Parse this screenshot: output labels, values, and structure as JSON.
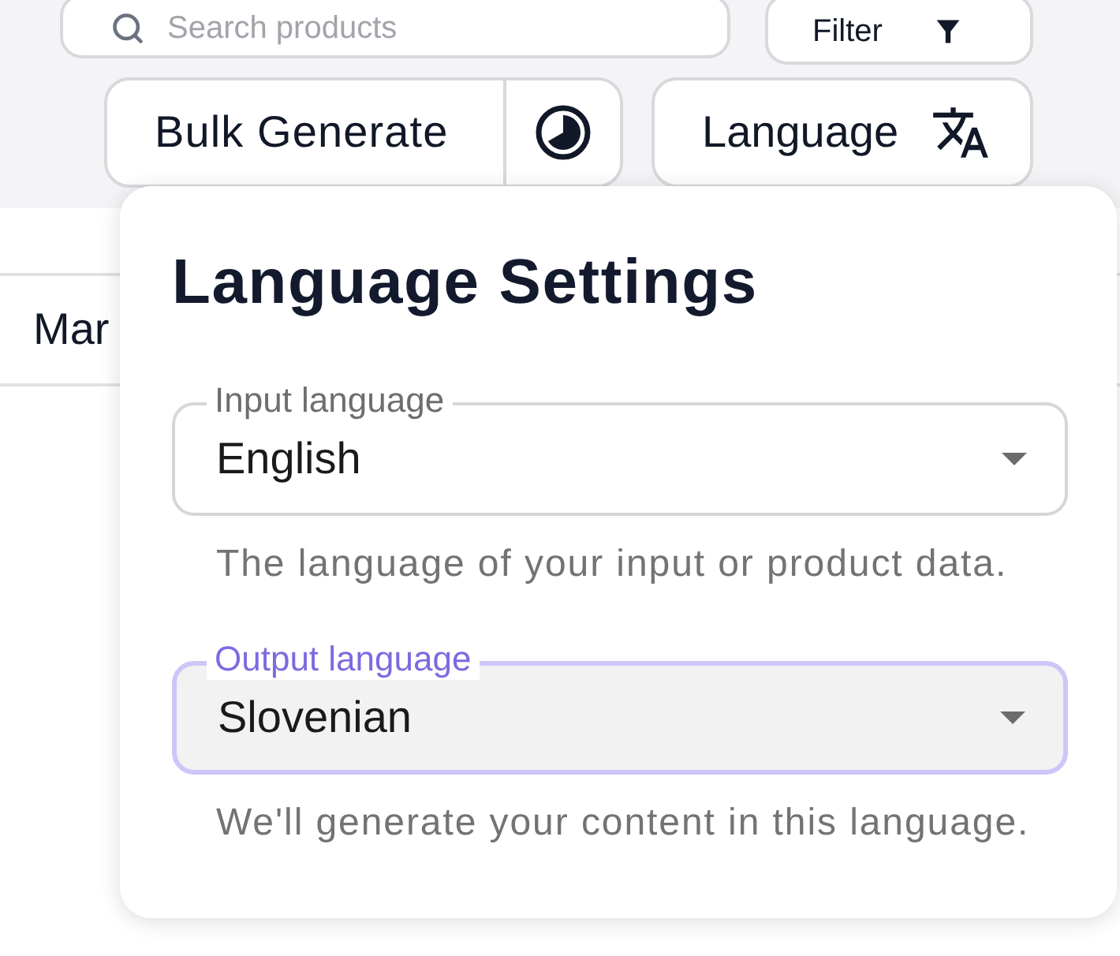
{
  "toolbar": {
    "search": {
      "placeholder": "Search products"
    },
    "filter_button": {
      "label": "Filter"
    },
    "bulk_generate_button": {
      "label": "Bulk Generate"
    },
    "language_button": {
      "label": "Language"
    }
  },
  "table": {
    "cell": "Mar"
  },
  "language_settings": {
    "title": "Language Settings",
    "fields": [
      {
        "label": "Input language",
        "value": "English",
        "helper": "The language of your input or product data.",
        "focused": false
      },
      {
        "label": "Output language",
        "value": "Slovenian",
        "helper": "We'll generate your content in this language.",
        "focused": true
      }
    ]
  }
}
